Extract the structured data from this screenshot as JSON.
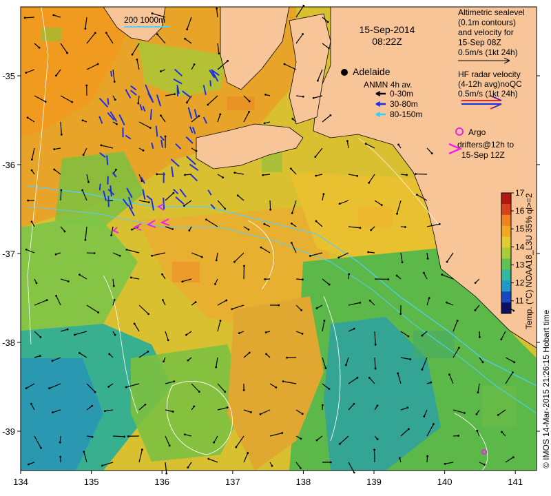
{
  "header": {
    "date": "15-Sep-2014",
    "time": "08:22Z"
  },
  "scale_bar": {
    "label": "200  1000m"
  },
  "place": {
    "name": "Adelaide"
  },
  "legend_altimetry": {
    "lines": [
      "Altimetric sealevel",
      "(0.1m contours)",
      "and velocity for",
      "15-Sep 08Z",
      "0.5m/s (1kt 24h)"
    ]
  },
  "legend_hf": {
    "lines": [
      "HF radar velocity",
      "(4-12h avg)noQC",
      "0.5m/s (1kt 24h)"
    ]
  },
  "legend_anmn": {
    "title": "ANMN 4h av.",
    "items": [
      {
        "label": "0-30m",
        "color": "#000000"
      },
      {
        "label": "30-80m",
        "color": "#1a2ee8"
      },
      {
        "label": "80-150m",
        "color": "#30d0ff"
      }
    ]
  },
  "legend_argo": {
    "lines": [
      "Argo",
      "drifters@12h to",
      "15-Sep 12Z"
    ],
    "color": "#ee22ee"
  },
  "colorbar": {
    "label": "Temp. (°C) NOAA18_L3U 35% ql>=2",
    "ticks": [
      "11",
      "12",
      "13",
      "14",
      "15",
      "16",
      "17"
    ],
    "min": 10.3,
    "max": 17
  },
  "credit": "© IMOS 14-Mar-2015 21:26:15 Hobart time",
  "axes": {
    "x_ticks": [
      "134",
      "135",
      "136",
      "137",
      "138",
      "139",
      "140",
      "141"
    ],
    "y_ticks": [
      "-35",
      "-36",
      "-37",
      "-38",
      "-39"
    ]
  },
  "colors": {
    "land": "#f8c598",
    "warm": "#f0a018",
    "mid": "#e8d030",
    "cool": "#58c050",
    "cold": "#2aa0a8"
  }
}
